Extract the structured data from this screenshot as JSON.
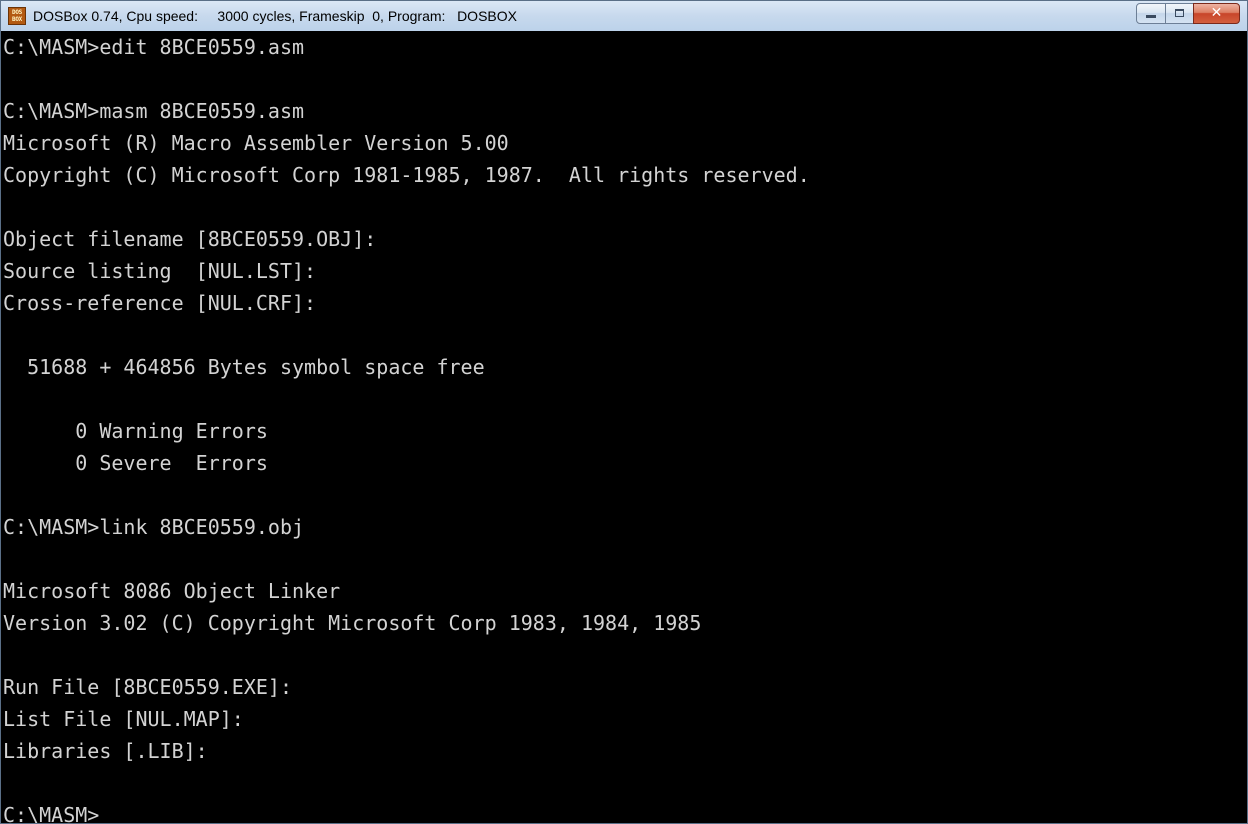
{
  "window": {
    "title": "DOSBox 0.74, Cpu speed:     3000 cycles, Frameskip  0, Program:   DOSBOX",
    "icon": "dosbox-icon",
    "icon_text": [
      "DOS",
      "BOX"
    ],
    "buttons": {
      "minimize": "minimize-icon",
      "maximize": "maximize-icon",
      "close": "close-icon",
      "close_glyph": "✕"
    }
  },
  "console": {
    "background": "#000000",
    "foreground": "#d3d3d3",
    "lines": [
      "C:\\MASM>edit 8BCE0559.asm",
      "",
      "C:\\MASM>masm 8BCE0559.asm",
      "Microsoft (R) Macro Assembler Version 5.00",
      "Copyright (C) Microsoft Corp 1981-1985, 1987.  All rights reserved.",
      "",
      "Object filename [8BCE0559.OBJ]:",
      "Source listing  [NUL.LST]:",
      "Cross-reference [NUL.CRF]:",
      "",
      "  51688 + 464856 Bytes symbol space free",
      "",
      "      0 Warning Errors",
      "      0 Severe  Errors",
      "",
      "C:\\MASM>link 8BCE0559.obj",
      "",
      "Microsoft 8086 Object Linker",
      "Version 3.02 (C) Copyright Microsoft Corp 1983, 1984, 1985",
      "",
      "Run File [8BCE0559.EXE]:",
      "List File [NUL.MAP]:",
      "Libraries [.LIB]:",
      "",
      "C:\\MASM>"
    ]
  }
}
